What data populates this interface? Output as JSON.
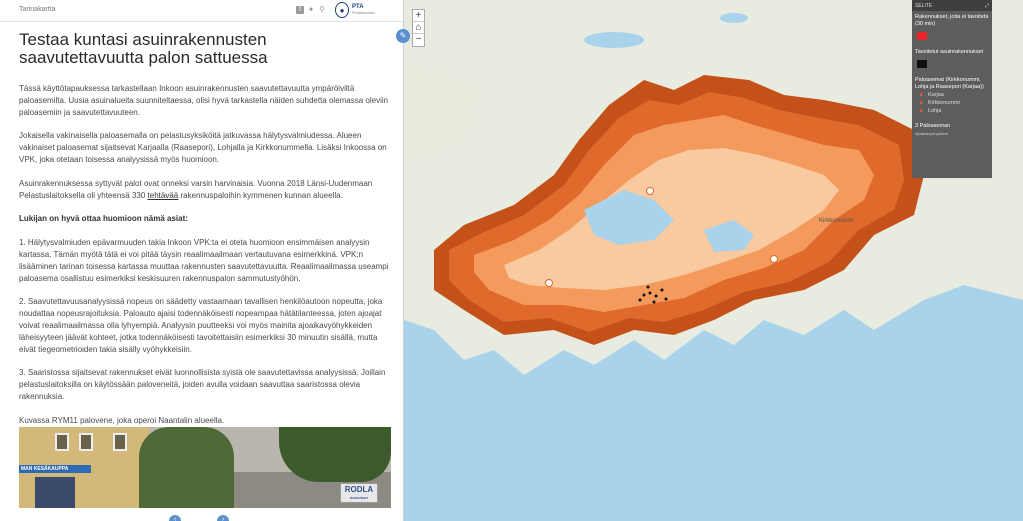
{
  "header": {
    "app_name": "Tarinakartta",
    "share_icons": [
      "facebook-icon",
      "twitter-icon",
      "link-icon"
    ],
    "logo_text": "PTA",
    "logo_subtext": "Pelastusalan"
  },
  "story": {
    "title": "Testaa kuntasi asuinrakennusten saavutettavuutta palon sattuessa",
    "p1": "Tässä käyttötapauksessa tarkastellaan Inkoon asuinrakennusten saavutettavuutta ympäröiviltä paloasemilta. Uusia asuinalueita suunniteltaessa, olisi hyvä tarkastella näiden suhdetta olemassa oleviin paloasemiin ja saavutettavuuteen.",
    "p2": "Jokaisella vakinaisella paloasemalla on pelastusyksiköitä jatkuvassa hälytysvalmiudessa. Alueen vakinaiset paloasemat sijaitsevat Karjaalla (Raasepori), Lohjalla ja Kirkkonummella. Lisäksi Inkoossa on VPK, joka otetaan toisessa analyysissä myös huomioon.",
    "p3_before": "Asuinrakennuksessa syttyvät palot ovat onneksi varsin harvinaisia. Vuonna 2018 Länsi-Uudenmaan Pelastuslaitoksella oli yhteensä 330 ",
    "p3_link": "tehtävää",
    "p3_after": " rakennuspaloihin kymmenen kunnan alueella.",
    "p4": "Lukijan on hyvä ottaa huomioon nämä asiat:",
    "p5": "1. Hälytysvalmiuden epävarmuuden takia Inkoon VPK:ta ei oteta huomioon ensimmäisen analyysin kartassa. Tämän myötä tätä ei voi pitää täysin reaalimaailmaan vertautuvana esimerkkinä. VPK:n lisääminen tarinan toisessa kartassa muuttaa rakennusten saavutettavuutta. Reaalimaailmassa useampi paloasema osallistuu esimerkiksi keskisuuren rakennuspalon sammutustyöhön.",
    "p6": "2. Saavutettavuusanalyysissä nopeus on säädetty vastaamaan tavallisen henkilöautoon nopeutta, joka noudattaa nopeusrajoituksia. Paloauto ajaisi todennäköisesti nopeampaa hätätilanteessa, joten ajoajat voivat reaalimaailmassa olla lyhyempiä. Analyysin puutteeksi voi myös mainita ajoaikavyöhykkeiden läheisyyteen jäävät kohteet, jotka todennäköisesti tavoitettaisiin esimerkiksi 30 minuutin sisällä, mutta eivät tiegeometrioiden takia sisälly vyöhykkeisiin.",
    "p7": "3. Saaristossa sijaitsevat rakennukset eivät luonnollisista syistä ole saavutettavissa analyysissä. Joillain pelastuslaitoksilla on käytössään paloveneitä, joiden avulla voidaan saavuttaa saaristossa olevia rakennuksia.",
    "caption": "Kuvassa RYM11 palovene, joka operoi Naantalin alueella.",
    "photo": {
      "shop_sign": "MAN KESÄKAUPPA",
      "truck_text": "RODLA",
      "truck_subtext": "RAKENTEET"
    }
  },
  "map": {
    "zoom_in": "+",
    "home": "⌂",
    "zoom_out": "−",
    "places": [
      "Kirkkonummi"
    ],
    "colors": {
      "water": "#a9d3ea",
      "land": "#e8ece0",
      "zone_light": "#f9c9a0",
      "zone_mid": "#f39a5c",
      "zone_dark": "#e0692c",
      "zone_darker": "#c4511a"
    }
  },
  "legend": {
    "header": "SELITE",
    "s1": "Rakennukset, joita ei tavoiteta (30 min)",
    "s1_color": "#e8262b",
    "s2": "Tavoitetut asuinrakennukset",
    "s2_color": "#111111",
    "s3": "Paloasemat (Kirkkonummi, Lohja ja Raasepori (Karjaa))",
    "stations": [
      "Karjaa",
      "Kirkkonummi",
      "Lohja"
    ],
    "s4": "3 Paloaseman",
    "s4_sub": "Ajoaikavyöhykkeet"
  }
}
